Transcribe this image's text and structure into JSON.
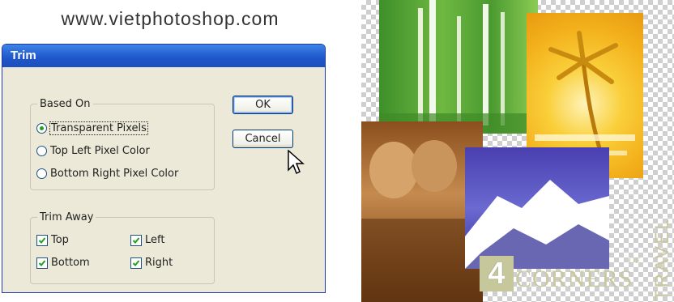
{
  "header": {
    "site_url": "www.vietphotoshop.com"
  },
  "dialog": {
    "title": "Trim",
    "based_on": {
      "legend": "Based On",
      "options": [
        {
          "label": "Transparent Pixels",
          "selected": true
        },
        {
          "label": "Top Left Pixel Color",
          "selected": false
        },
        {
          "label": "Bottom Right Pixel Color",
          "selected": false
        }
      ]
    },
    "trim_away": {
      "legend": "Trim Away",
      "top": {
        "label": "Top",
        "checked": true
      },
      "bottom": {
        "label": "Bottom",
        "checked": true
      },
      "left": {
        "label": "Left",
        "checked": true
      },
      "right": {
        "label": "Right",
        "checked": true
      }
    },
    "buttons": {
      "ok": "OK",
      "cancel": "Cancel"
    }
  },
  "image": {
    "logo_number": "4",
    "logo_word": "CORNERS",
    "logo_of": "OF",
    "logo_travel": "TRAVEL"
  },
  "colors": {
    "titlebar": "#1f56c9",
    "dialog_bg": "#ece9d8",
    "radio_dot": "#21a121",
    "checkmark": "#21a121"
  }
}
